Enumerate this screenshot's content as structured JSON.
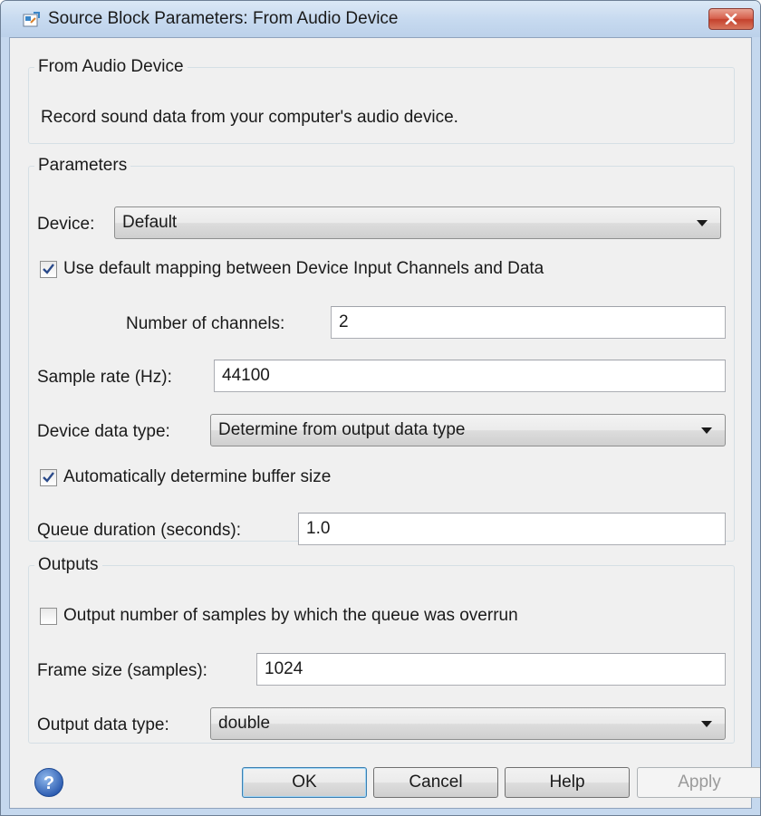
{
  "window": {
    "title": "Source Block Parameters: From Audio Device"
  },
  "description_group": {
    "title": "From Audio Device",
    "text": "Record sound data from your computer's audio device."
  },
  "parameters": {
    "title": "Parameters",
    "device": {
      "label": "Device:",
      "value": "Default"
    },
    "use_default_mapping": {
      "label": "Use default mapping between Device Input Channels and Data",
      "checked": true
    },
    "num_channels": {
      "label": "Number of channels:",
      "value": "2"
    },
    "sample_rate": {
      "label": "Sample rate (Hz):",
      "value": "44100"
    },
    "device_data_type": {
      "label": "Device data type:",
      "value": "Determine from output data type"
    },
    "auto_buffer": {
      "label": "Automatically determine buffer size",
      "checked": true
    },
    "queue_duration": {
      "label": "Queue duration (seconds):",
      "value": "1.0"
    }
  },
  "outputs": {
    "title": "Outputs",
    "output_overrun": {
      "label": "Output number of samples by which the queue was overrun",
      "checked": false
    },
    "frame_size": {
      "label": "Frame size (samples):",
      "value": "1024"
    },
    "output_data_type": {
      "label": "Output data type:",
      "value": "double"
    }
  },
  "buttons": {
    "ok": "OK",
    "cancel": "Cancel",
    "help": "Help",
    "apply": "Apply"
  },
  "icons": {
    "title": "simulink-block-icon",
    "close": "close-icon",
    "help": "help-icon",
    "dropdown": "chevron-down-icon"
  },
  "colors": {
    "titlebar": "#c6d9ef",
    "close_button": "#c4412c",
    "dialog_bg": "#f0f0f0",
    "check_mark": "#2a4a8a"
  }
}
